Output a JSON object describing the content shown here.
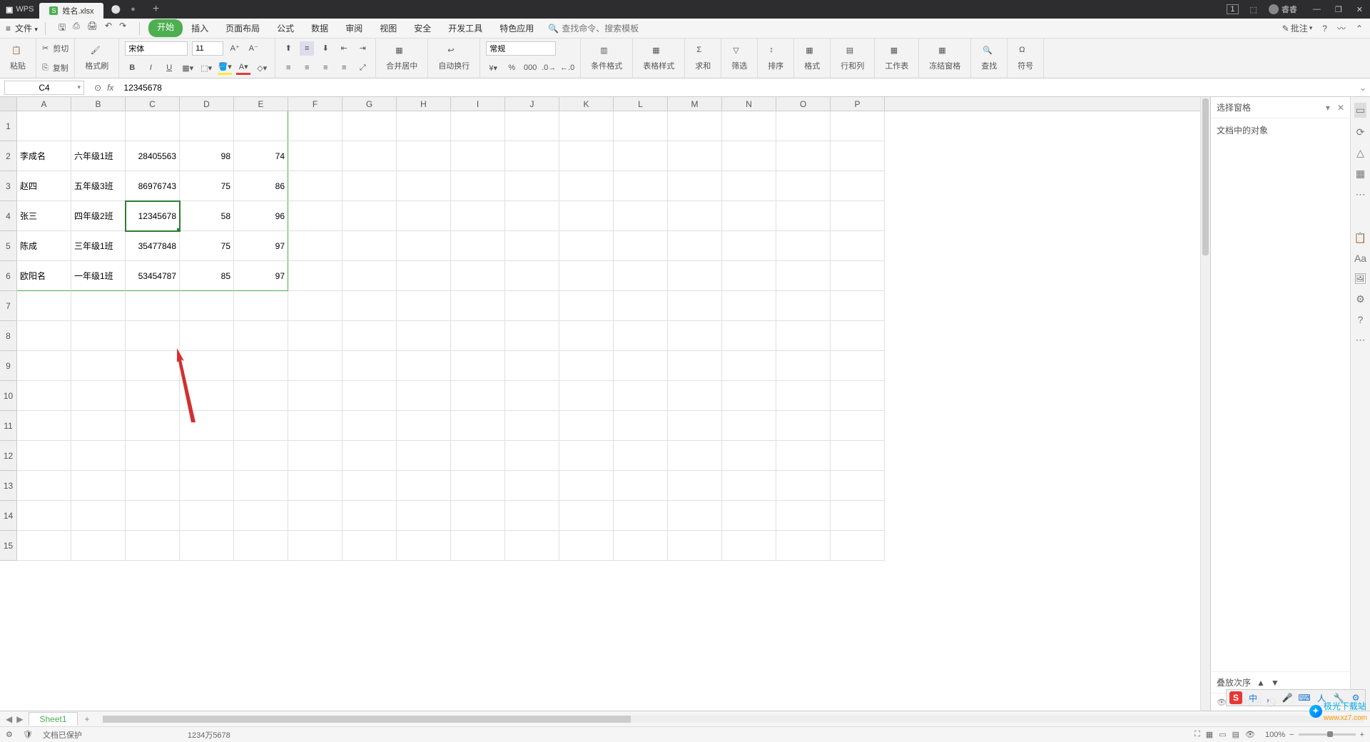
{
  "titlebar": {
    "app": "WPS",
    "doc_name": "姓名.xlsx",
    "add_tab": "+",
    "badge": "1",
    "user": "睿睿",
    "min": "—",
    "restore": "❐",
    "close": "✕"
  },
  "menubar": {
    "hamburger": "≡",
    "file": "文件",
    "tabs": [
      "开始",
      "插入",
      "页面布局",
      "公式",
      "数据",
      "审阅",
      "视图",
      "安全",
      "开发工具",
      "特色应用"
    ],
    "active_tab_index": 0,
    "search_placeholder": "查找命令、搜索模板",
    "search_icon_label": "🔍",
    "annotate": "批注",
    "help": "?",
    "collapse": "⌃"
  },
  "ribbon": {
    "paste": "粘贴",
    "cut": "剪切",
    "copy": "复制",
    "format_painter": "格式刷",
    "font": "宋体",
    "font_size": "11",
    "merge_center": "合并居中",
    "auto_wrap": "自动换行",
    "number_format": "常规",
    "cond_format": "条件格式",
    "table_style": "表格样式",
    "sum": "求和",
    "filter": "筛选",
    "sort": "排序",
    "format": "格式",
    "rowcol": "行和列",
    "worksheet": "工作表",
    "freeze": "冻结窗格",
    "find": "查找",
    "symbol": "符号"
  },
  "formula": {
    "cell_ref": "C4",
    "fx": "fx",
    "value": "12345678"
  },
  "columns": [
    "A",
    "B",
    "C",
    "D",
    "E",
    "F",
    "G",
    "H",
    "I",
    "J",
    "K",
    "L",
    "M",
    "N",
    "O",
    "P"
  ],
  "row_numbers": [
    "1",
    "2",
    "3",
    "4",
    "5",
    "6",
    "7",
    "8",
    "9",
    "10",
    "11",
    "12",
    "13",
    "14",
    "15"
  ],
  "data": {
    "r2": {
      "a": "李成名",
      "b": "六年级1班",
      "c": "28405563",
      "d": "98",
      "e": "74"
    },
    "r3": {
      "a": "赵四",
      "b": "五年级3班",
      "c": "86976743",
      "d": "75",
      "e": "86"
    },
    "r4": {
      "a": "张三",
      "b": "四年级2班",
      "c": "12345678",
      "d": "58",
      "e": "96"
    },
    "r5": {
      "a": "陈成",
      "b": "三年级1班",
      "c": "35477848",
      "d": "75",
      "e": "97"
    },
    "r6": {
      "a": "欧阳名",
      "b": "一年级1班",
      "c": "53454787",
      "d": "85",
      "e": "97"
    }
  },
  "taskpane": {
    "title": "选择窗格",
    "close": "✕",
    "body": "文档中的对象",
    "footer_label": "叠放次序",
    "show_all": "全部显示"
  },
  "sheet_tabs": {
    "sheet1": "Sheet1",
    "add": "+"
  },
  "statusbar": {
    "protect": "文档已保护",
    "display_val": "1234万5678",
    "zoom": "100%",
    "minus": "−",
    "plus": "+"
  },
  "ime": {
    "s": "S",
    "cn": "中",
    "punct": "，",
    "mic": "🎤",
    "kb": "⌨",
    "a": "人",
    "tool": "🔧",
    "cfg": "⚙"
  },
  "watermark": {
    "text": "极光下载站",
    "url": "www.xz7.com"
  }
}
